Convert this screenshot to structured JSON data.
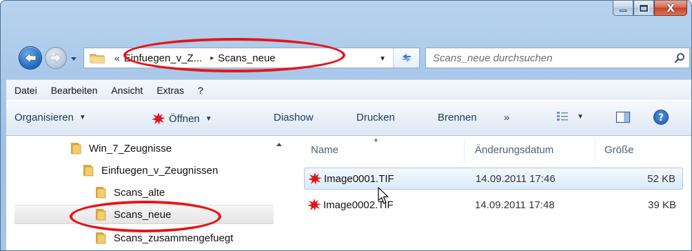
{
  "window": {
    "caption_buttons": {
      "minimize": "minimize",
      "maximize": "maximize",
      "close": "X"
    }
  },
  "address_bar": {
    "chevron": "«",
    "segment_1": "Einfuegen_v_Z...",
    "separator": "▸",
    "segment_2": "Scans_neue"
  },
  "search": {
    "placeholder": "Scans_neue durchsuchen"
  },
  "menu": [
    "Datei",
    "Bearbeiten",
    "Ansicht",
    "Extras",
    "?"
  ],
  "command_bar": {
    "organize": "Organisieren",
    "open": "Öffnen",
    "slideshow": "Diashow",
    "print": "Drucken",
    "burn": "Brennen",
    "more": "»"
  },
  "tree": [
    {
      "label": "Win_7_Zeugnisse"
    },
    {
      "label": "Einfuegen_v_Zeugnissen"
    },
    {
      "label": "Scans_alte"
    },
    {
      "label": "Scans_neue"
    },
    {
      "label": "Scans_zusammengefuegt"
    }
  ],
  "columns": {
    "name": "Name",
    "date": "Änderungsdatum",
    "size": "Größe"
  },
  "files": [
    {
      "name": "Image0001.TIF",
      "date": "14.09.2011 17:46",
      "size": "52 KB"
    },
    {
      "name": "Image0002.TIF",
      "date": "14.09.2011 17:48",
      "size": "39 KB"
    }
  ],
  "colors": {
    "annotation": "#e5151b",
    "accent": "#1e395b"
  }
}
